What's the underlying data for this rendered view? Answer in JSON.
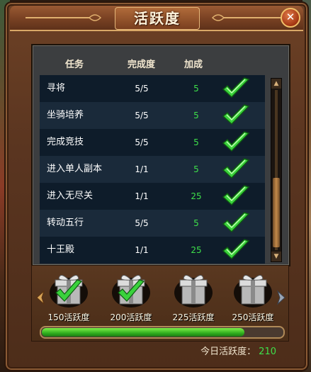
{
  "window": {
    "title": "活跃度",
    "close_label": "✕"
  },
  "table": {
    "headers": {
      "task": "任务",
      "progress": "完成度",
      "bonus": "加成"
    },
    "rows": [
      {
        "name": "寻将",
        "progress": "5/5",
        "bonus": "5",
        "completed": true
      },
      {
        "name": "坐骑培养",
        "progress": "5/5",
        "bonus": "5",
        "completed": true
      },
      {
        "name": "完成竞技",
        "progress": "5/5",
        "bonus": "5",
        "completed": true
      },
      {
        "name": "进入单人副本",
        "progress": "1/1",
        "bonus": "5",
        "completed": true
      },
      {
        "name": "进入无尽关",
        "progress": "1/1",
        "bonus": "25",
        "completed": true
      },
      {
        "name": "转动五行",
        "progress": "5/5",
        "bonus": "5",
        "completed": true
      },
      {
        "name": "十王殿",
        "progress": "1/1",
        "bonus": "25",
        "completed": true
      }
    ]
  },
  "rewards": {
    "items": [
      {
        "label": "150活跃度",
        "claimed": true
      },
      {
        "label": "200活跃度",
        "claimed": true
      },
      {
        "label": "225活跃度",
        "claimed": false
      },
      {
        "label": "250活跃度",
        "claimed": false
      }
    ],
    "progress_fraction": 0.84
  },
  "today": {
    "label": "今日活跃度：",
    "value": "210"
  },
  "colors": {
    "accent_green": "#3ee04a",
    "frame_brown": "#5a3520",
    "row_dark": "#0e1c2a"
  }
}
